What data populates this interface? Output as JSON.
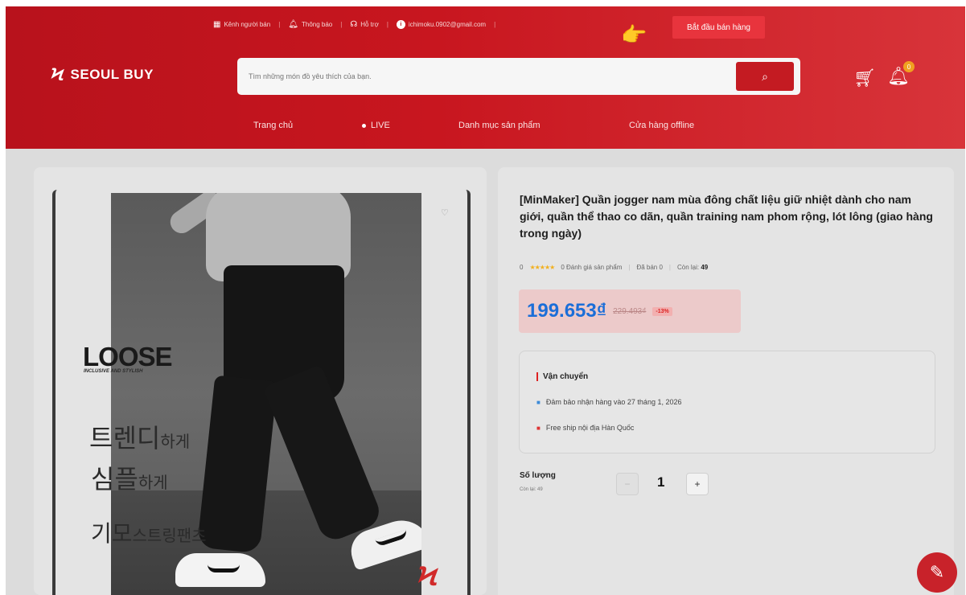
{
  "topbar": {
    "seller_channel": "Kênh người bán",
    "notifications": "Thông báo",
    "support": "Hỗ trợ",
    "account_email": "ichimoku.0902@gmail.com",
    "account_initial": "i",
    "start_selling": "Bắt đầu bán hàng"
  },
  "brand": {
    "logo_mark": "Ϟ",
    "name": "SEOUL BUY"
  },
  "search": {
    "placeholder": "Tìm những món đồ yêu thích của bạn."
  },
  "header_icons": {
    "cart": "cart-icon",
    "notification_badge": "0"
  },
  "nav": [
    {
      "label": "Trang chủ"
    },
    {
      "label": "LIVE"
    },
    {
      "label": "Danh mục sản phẩm"
    },
    {
      "label": "Cửa hàng offline"
    }
  ],
  "product_image": {
    "headline": "LOOSE",
    "subline": "INCLUSIVE AND STYLISH",
    "kr_line1_big": "트렌디",
    "kr_line1_small": "하게",
    "kr_line2_big": "심플",
    "kr_line2_small": "하게",
    "kr_line3_big": "기모",
    "kr_line3_small": "스트링팬츠"
  },
  "product": {
    "title": "[MinMaker] Quần jogger nam mùa đông chất liệu giữ nhiệt dành cho nam giới, quần thể thao co dãn, quần training nam phom rộng, lót lông (giao hàng trong ngày)",
    "rating_value": "0",
    "stars": "★★★★★",
    "reviews": "0 Đánh giá sản phẩm",
    "sold": "Đã bán 0",
    "stock_label": "Còn lại:",
    "stock_value": "49",
    "price": "199.653₫",
    "old_price": "229.493₫",
    "discount": "-13%"
  },
  "shipping": {
    "title": "Vận chuyển",
    "delivery": "Đảm bảo nhận hàng vào 27 tháng 1, 2026",
    "free_ship": "Free ship nội địa Hàn Quốc"
  },
  "quantity": {
    "label": "Số lượng",
    "stock_note": "Còn lại: 49",
    "value": "1",
    "minus": "−",
    "plus": "+"
  },
  "colors": {
    "header_red": "#c8161f",
    "price_blue": "#1b6ed8",
    "accent_red": "#e8343d"
  }
}
